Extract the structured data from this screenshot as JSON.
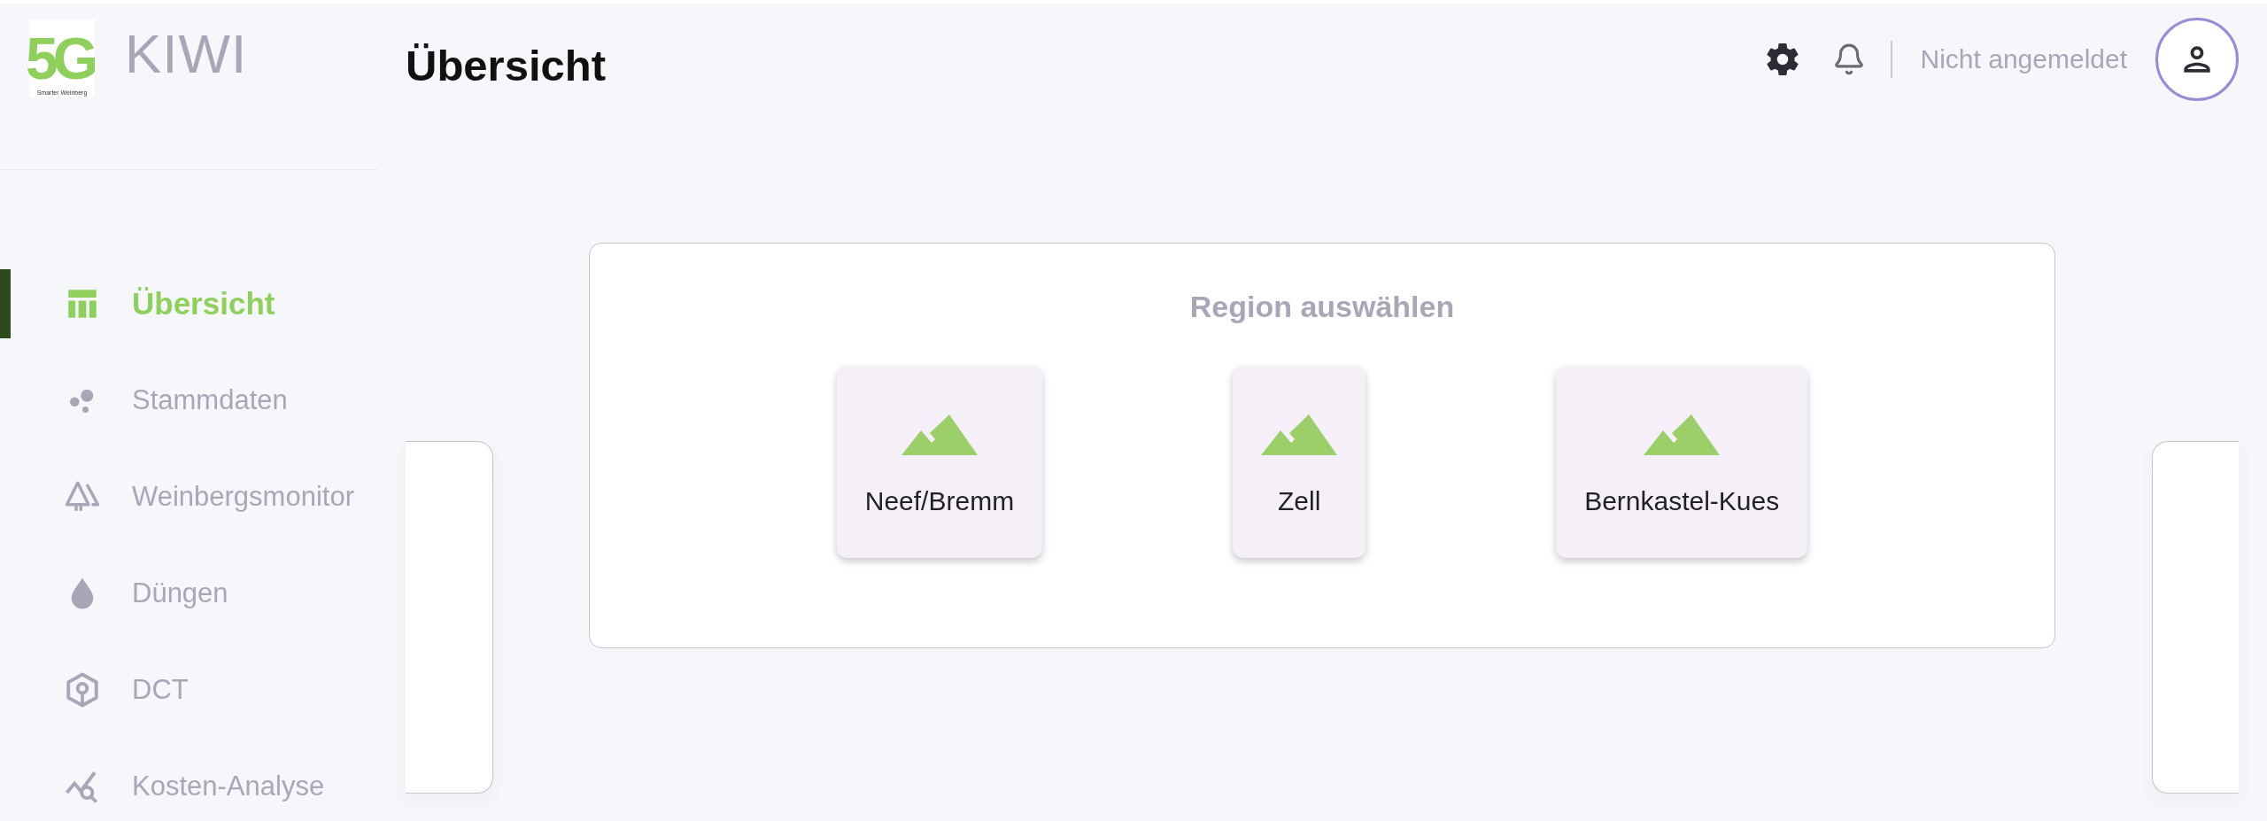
{
  "brand": {
    "logo_mark": "5G",
    "logo_caption": "Smarter Weinberg",
    "name": "KIWI"
  },
  "sidebar": {
    "items": [
      {
        "label": "Übersicht",
        "kind": "table",
        "selected": true
      },
      {
        "label": "Stammdaten",
        "kind": "bubbles",
        "selected": false
      },
      {
        "label": "Weinbergsmonitor",
        "kind": "trees",
        "selected": false
      },
      {
        "label": "Düngen",
        "kind": "drop",
        "selected": false
      },
      {
        "label": "DCT",
        "kind": "cube",
        "selected": false
      },
      {
        "label": "Kosten-Analyse",
        "kind": "chart-search",
        "selected": false
      }
    ]
  },
  "header": {
    "title": "Übersicht",
    "user_status": "Nicht angemeldet"
  },
  "region_picker": {
    "title": "Region auswählen",
    "regions": [
      {
        "label": "Neef/Bremm"
      },
      {
        "label": "Zell"
      },
      {
        "label": "Bernkastel-Kues"
      }
    ]
  }
}
